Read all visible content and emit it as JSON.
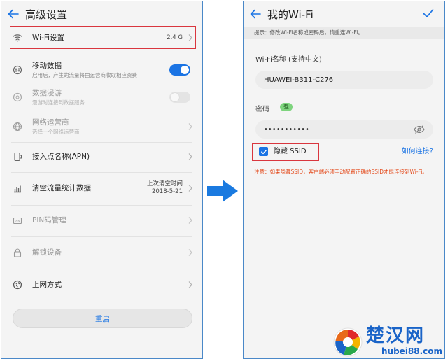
{
  "left": {
    "title": "高级设置",
    "rows": [
      {
        "title": "Wi-Fi设置",
        "value": "2.4 G"
      },
      {
        "title": "移动数据",
        "sub": "启用后，产生的流量将由运营商收取相应资费"
      },
      {
        "title": "数据漫游",
        "sub": "漫游时连接到数据服务"
      },
      {
        "title": "网络运营商",
        "sub": "选择一个网络运营商"
      },
      {
        "title": "接入点名称(APN)"
      },
      {
        "title": "清空流量统计数据",
        "value_line1": "上次清空时间",
        "value_line2": "2018-5-21"
      },
      {
        "title": "PIN码管理"
      },
      {
        "title": "解锁设备"
      },
      {
        "title": "上网方式"
      }
    ],
    "reset_label": "重启"
  },
  "right": {
    "title": "我的Wi-Fi",
    "hint": "提示：修改Wi-Fi名称或密码后，请重连Wi-Fi。",
    "name_label": "Wi-Fi名称 (支持中文)",
    "name_value": "HUAWEI-B311-C276",
    "password_label": "密码",
    "strength": "强",
    "password_value": "•••••••••••",
    "hide_ssid_label": "隐藏 SSID",
    "how_to_connect": "如何连接?",
    "warning": "注意：如果隐藏SSID，客户端必须手动配置正确的SSID才能连接到Wi-Fi。"
  },
  "watermark": {
    "name": "楚汉网",
    "url": "hubei88.com"
  },
  "colors": {
    "accent": "#1b74e4",
    "highlight": "#d9363e",
    "warning": "#e44d1f"
  }
}
